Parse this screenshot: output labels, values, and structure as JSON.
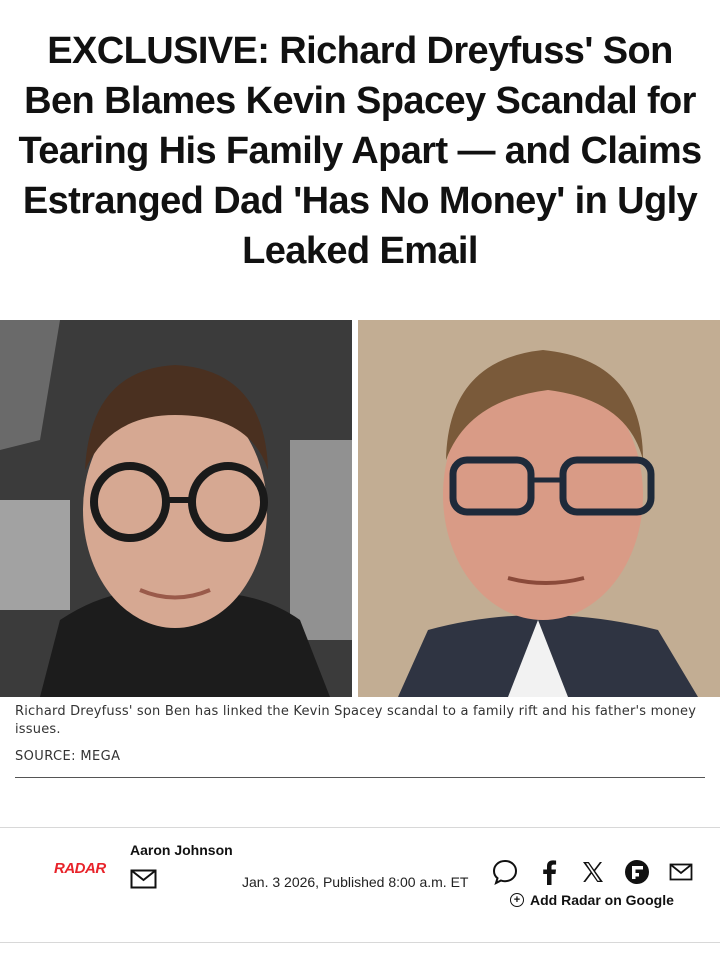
{
  "article": {
    "headline": "EXCLUSIVE: Richard Dreyfuss' Son Ben Blames Kevin Spacey Scandal for Tearing His Family Apart — and Claims Estranged Dad 'Has No Money' in Ugly Leaked Email",
    "caption": "Richard Dreyfuss' son Ben has linked the Kevin Spacey scandal to a family rift and his father's money issues.",
    "source": "SOURCE: MEGA"
  },
  "byline": {
    "logo_text": "RADAR",
    "author": "Aaron Johnson",
    "date": "Jan. 3 2026, Published 8:00 a.m. ET"
  },
  "share": {
    "icons": [
      "comment-icon",
      "facebook-icon",
      "x-icon",
      "flipboard-icon",
      "email-icon"
    ],
    "add_google": "Add Radar on Google"
  },
  "colors": {
    "brand": "#e8232a",
    "text": "#111111"
  }
}
